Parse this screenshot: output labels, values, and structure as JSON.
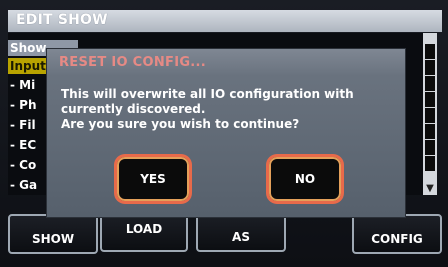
{
  "header": {
    "title": "EDIT SHOW"
  },
  "list": {
    "show_row": "Show",
    "input_row": "Input",
    "items": [
      "- Mi",
      "- Ph",
      "- Fil",
      "- EC",
      "- Co",
      "- Ga"
    ]
  },
  "dialog": {
    "title": "RESET IO CONFIG...",
    "lines": [
      "This will overwrite all IO configuration with",
      "currently discovered.",
      "Are you sure you wish to continue?"
    ],
    "yes_label": "YES",
    "no_label": "NO"
  },
  "softkeys": {
    "b1": "SHOW",
    "b2": "LOAD",
    "b3": "AS",
    "b4": "CONFIG"
  },
  "colors": {
    "dialog_title": "#e68a85",
    "button_glow": "#e86a4a",
    "input_row": "#b8a300"
  },
  "icons": {
    "scroll_down": "triangle-down-icon"
  }
}
